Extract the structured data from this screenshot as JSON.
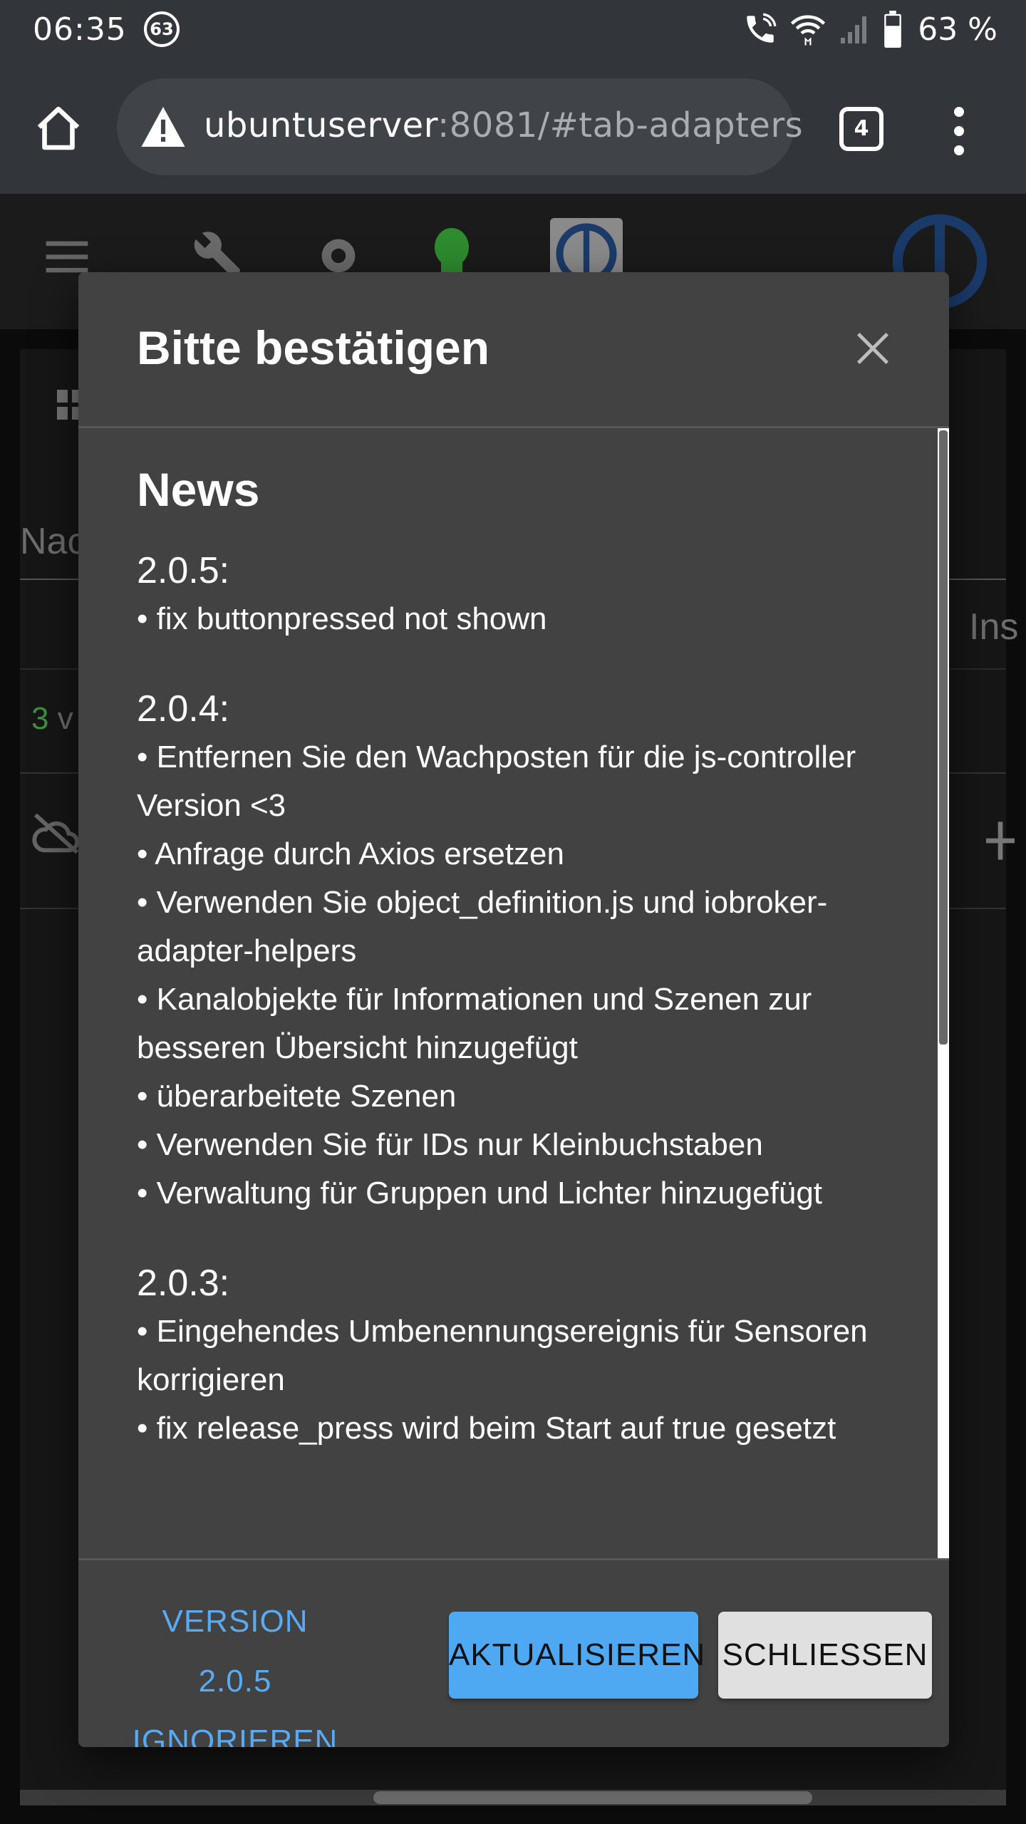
{
  "status_bar": {
    "time": "06:35",
    "notification_count": "63",
    "battery_percent": "63 %",
    "icons": [
      "call-wifi-icon",
      "wifi-icon",
      "signal-icon",
      "battery-icon"
    ]
  },
  "browser": {
    "url_host": "ubuntuserver",
    "url_rest": ":8081/#tab-adapters",
    "tab_count": "4",
    "security_icon": "warning-icon"
  },
  "background_page": {
    "filter_label_partial": "Nac",
    "count_partial": "3",
    "count_partial_suffix": "v",
    "column_partial": "Ins",
    "accent_color": "#4caf50"
  },
  "dialog": {
    "title": "Bitte bestätigen",
    "news_heading": "News",
    "versions": [
      {
        "version": "2.0.5:",
        "entries": [
          "• fix buttonpressed not shown"
        ]
      },
      {
        "version": "2.0.4:",
        "entries": [
          "• Entfernen Sie den Wachposten für die js-controller Version <3",
          "• Anfrage durch Axios ersetzen",
          "• Verwenden Sie object_definition.js und iobroker-adapter-helpers",
          "• Kanalobjekte für Informationen und Szenen zur besseren Übersicht hinzugefügt",
          "• überarbeitete Szenen",
          "• Verwenden Sie für IDs nur Kleinbuchstaben",
          "• Verwaltung für Gruppen und Lichter hinzugefügt"
        ]
      },
      {
        "version": "2.0.3:",
        "entries": [
          "• Eingehendes Umbenennungsereignis für Sensoren korrigieren",
          "• fix release_press wird beim Start auf true gesetzt"
        ]
      }
    ],
    "actions": {
      "ignore_line1": "VERSION 2.0.5",
      "ignore_line2": "IGNORIEREN",
      "update": "AKTUALISIEREN",
      "close": "SCHLIESSEN"
    },
    "colors": {
      "background": "#424242",
      "primary": "#4fa8f2",
      "link": "#58aaf2",
      "secondary_button": "#e0e0e0"
    }
  }
}
